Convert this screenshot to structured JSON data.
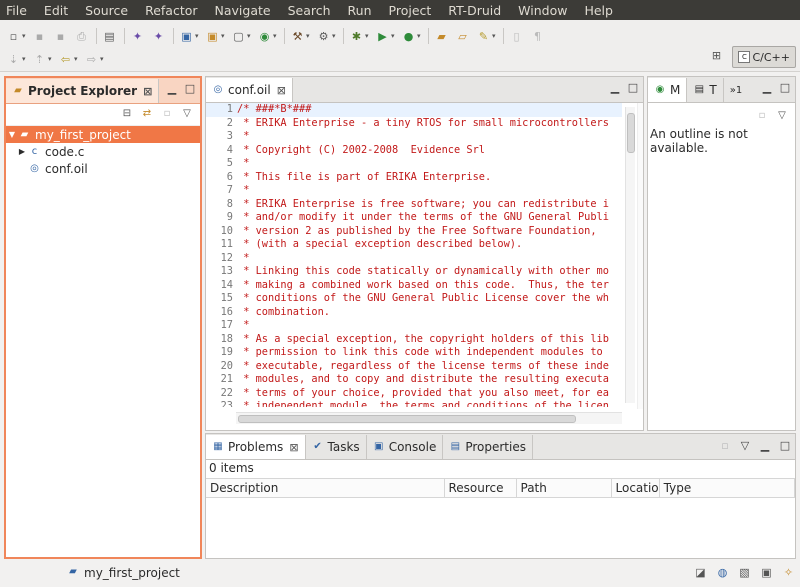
{
  "menu": [
    "File",
    "Edit",
    "Source",
    "Refactor",
    "Navigate",
    "Search",
    "Run",
    "Project",
    "RT-Druid",
    "Window",
    "Help"
  ],
  "perspective": {
    "label": "C/C++"
  },
  "explorer": {
    "title": "Project Explorer",
    "tree": [
      {
        "label": "my_first_project",
        "icon": "project-folder-icon",
        "expanded": true,
        "selected": true
      },
      {
        "label": "code.c",
        "icon": "c-file-icon",
        "expandable": true
      },
      {
        "label": "conf.oil",
        "icon": "oil-file-icon"
      }
    ]
  },
  "editor": {
    "tab_title": "conf.oil",
    "lines": [
      {
        "n": "1",
        "text": "/* ###*B*###"
      },
      {
        "n": "2",
        "text": " * ERIKA Enterprise - a tiny RTOS for small microcontrollers"
      },
      {
        "n": "3",
        "text": " *"
      },
      {
        "n": "4",
        "text": " * Copyright (C) 2002-2008  Evidence Srl"
      },
      {
        "n": "5",
        "text": " *"
      },
      {
        "n": "6",
        "text": " * This file is part of ERIKA Enterprise."
      },
      {
        "n": "7",
        "text": " *"
      },
      {
        "n": "8",
        "text": " * ERIKA Enterprise is free software; you can redistribute i"
      },
      {
        "n": "9",
        "text": " * and/or modify it under the terms of the GNU General Publi"
      },
      {
        "n": "10",
        "text": " * version 2 as published by the Free Software Foundation,"
      },
      {
        "n": "11",
        "text": " * (with a special exception described below)."
      },
      {
        "n": "12",
        "text": " *"
      },
      {
        "n": "13",
        "text": " * Linking this code statically or dynamically with other mo"
      },
      {
        "n": "14",
        "text": " * making a combined work based on this code.  Thus, the ter"
      },
      {
        "n": "15",
        "text": " * conditions of the GNU General Public License cover the wh"
      },
      {
        "n": "16",
        "text": " * combination."
      },
      {
        "n": "17",
        "text": " *"
      },
      {
        "n": "18",
        "text": " * As a special exception, the copyright holders of this lib"
      },
      {
        "n": "19",
        "text": " * permission to link this code with independent modules to"
      },
      {
        "n": "20",
        "text": " * executable, regardless of the license terms of these inde"
      },
      {
        "n": "21",
        "text": " * modules, and to copy and distribute the resulting executa"
      },
      {
        "n": "22",
        "text": " * terms of your choice, provided that you also meet, for ea"
      },
      {
        "n": "23",
        "text": " * independent module, the terms and conditions of the licen"
      }
    ]
  },
  "outline": {
    "tab_m": "M",
    "tab_t": "T",
    "overflow": "»1",
    "message": "An outline is not available."
  },
  "problems": {
    "tabs": [
      "Problems",
      "Tasks",
      "Console",
      "Properties"
    ],
    "count": "0 items",
    "columns": [
      "Description",
      "Resource",
      "Path",
      "Locatio",
      "Type"
    ]
  },
  "status": {
    "selection": "my_first_project"
  }
}
